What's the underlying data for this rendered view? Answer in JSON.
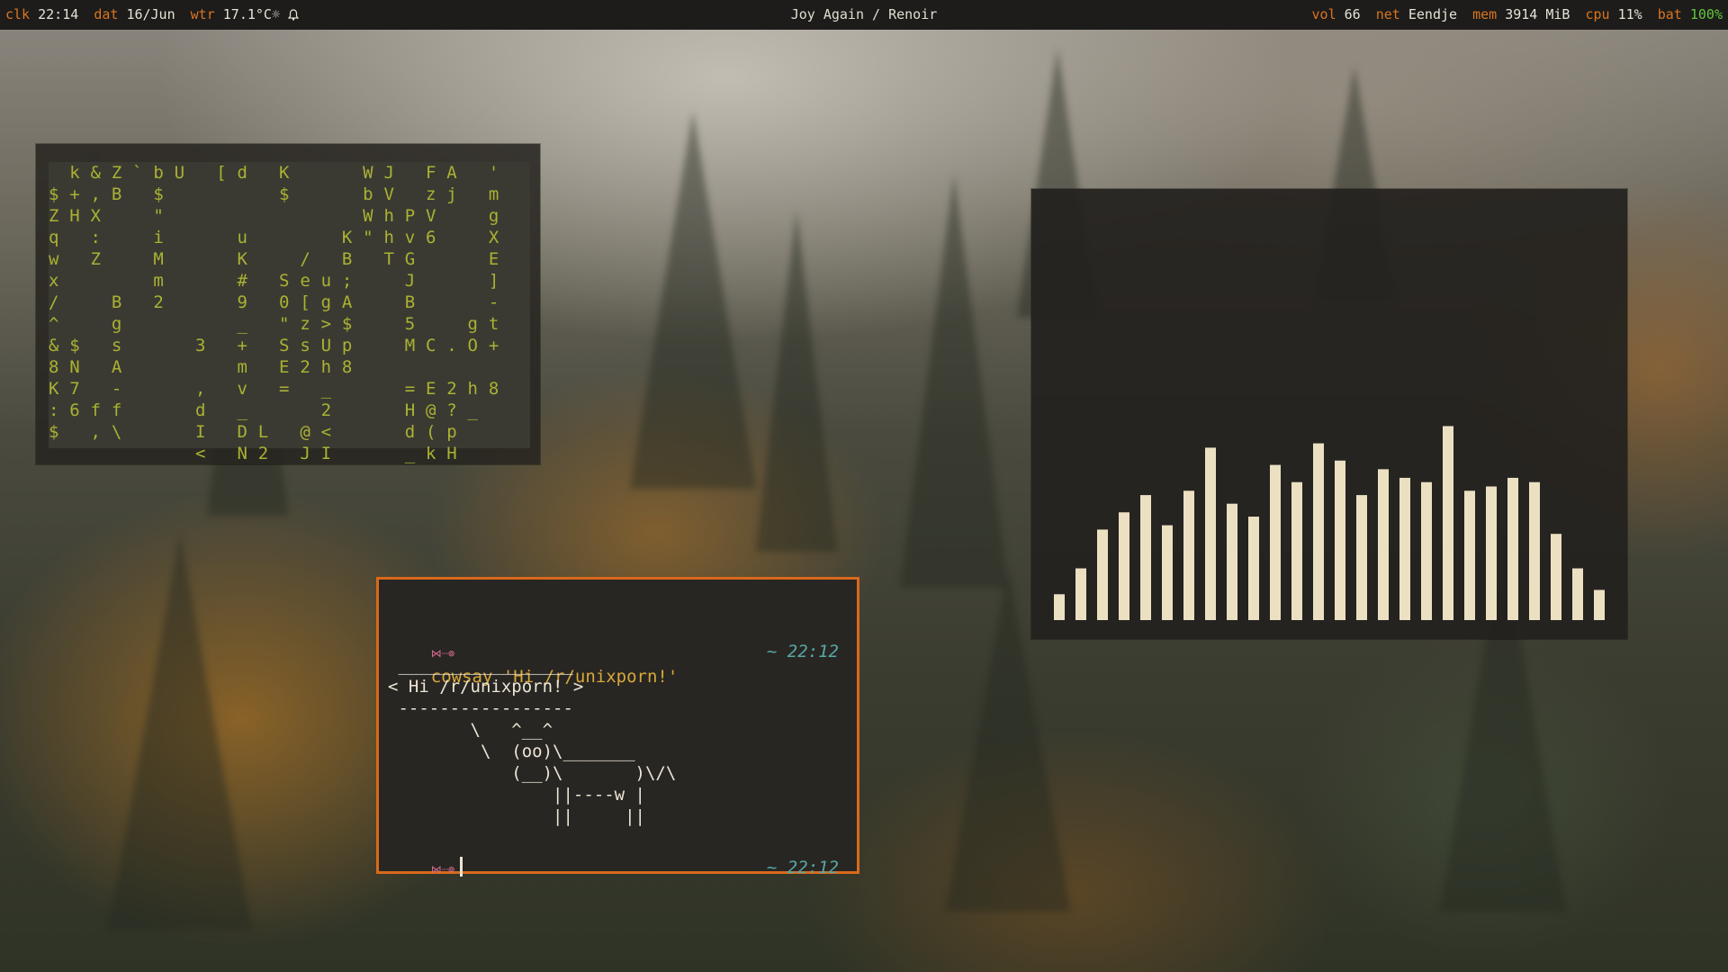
{
  "statusbar": {
    "clk_label": "clk",
    "clk_value": "22:14",
    "dat_label": "dat",
    "dat_value": "16/Jun",
    "wtr_label": "wtr",
    "wtr_value": "17.1°C☼",
    "now_playing": "Joy Again / Renoir",
    "vol_label": "vol",
    "vol_value": "66",
    "net_label": "net",
    "net_value": "Eendje",
    "mem_label": "mem",
    "mem_value": "3914 MiB",
    "cpu_label": "cpu",
    "cpu_value": "11%",
    "bat_label": "bat",
    "bat_value": "100%"
  },
  "matrix": {
    "text": "  k & Z ` b U   [ d   K       W J   F A   '\n$ + , B   $           $       b V   z j   m\nZ H X     \"                   W h P V     g\nq   :     i       u         K \" h v 6     X\nw   Z     M       K     /   B   T G       E\nx         m       #   S e u ;     J       ]\n/     B   2       9   0 [ g A     B       -\n^     g           _   \" z > $     5     g t\n& $   s       3   +   S s U p     M C . O +\n8 N   A           m   E 2 h 8\nK 7   -       ,   v   =   _       = E 2 h 8\n: 6 f f       d   _       2       H @ ? _\n$   , \\       I   D L   @ <       d ( p\n              <   N 2   J I       _ k H"
  },
  "visualizer": {
    "bar_color": "#ece0c3",
    "levels": [
      0.06,
      0.12,
      0.21,
      0.25,
      0.29,
      0.22,
      0.3,
      0.4,
      0.27,
      0.24,
      0.36,
      0.32,
      0.41,
      0.37,
      0.29,
      0.35,
      0.33,
      0.32,
      0.45,
      0.3,
      0.31,
      0.33,
      0.32,
      0.2,
      0.12,
      0.07
    ]
  },
  "terminal": {
    "prompt_symbol": "⋈┈⊚",
    "command": "cowsay 'Hi /r/unixporn!'",
    "time_tilde": "~",
    "time_1": "22:12",
    "time_2": "22:12",
    "cowsay_output": " _________________\n< Hi /r/unixporn! >\n -----------------\n        \\   ^__^\n         \\  (oo)\\_______\n            (__)\\       )\\/\\\n                ||----w |\n                ||     ||"
  }
}
